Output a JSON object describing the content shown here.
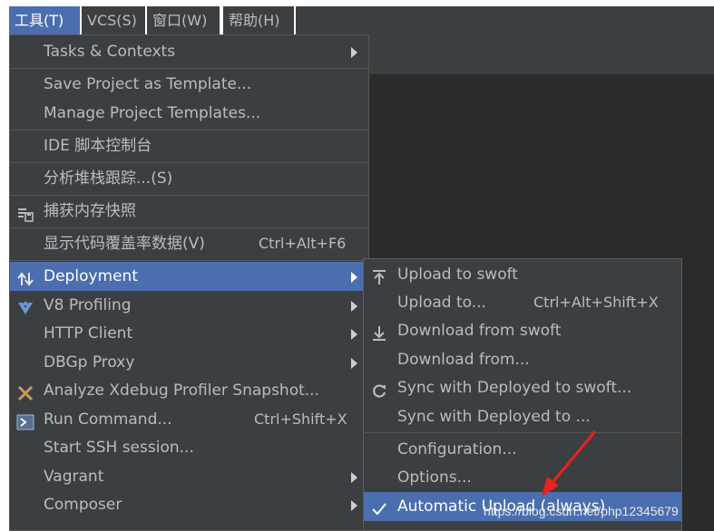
{
  "menubar": {
    "items": [
      {
        "label": "工具(T)"
      },
      {
        "label": "VCS(S)"
      },
      {
        "label": "窗口(W)"
      },
      {
        "label": "帮助(H)"
      }
    ]
  },
  "main_menu": {
    "items": [
      {
        "label": "Tasks & Contexts"
      },
      {
        "label": "Save Project as Template..."
      },
      {
        "label": "Manage Project Templates..."
      },
      {
        "label": "IDE 脚本控制台"
      },
      {
        "label": "分析堆栈跟踪...(S)"
      },
      {
        "label": "捕获内存快照",
        "icon": "memory-snapshot-icon"
      },
      {
        "label": "显示代码覆盖率数据(V)",
        "shortcut": "Ctrl+Alt+F6"
      },
      {
        "label": "Deployment",
        "icon": "deployment-icon",
        "selected": true
      },
      {
        "label": "V8 Profiling",
        "icon": "v8-icon"
      },
      {
        "label": "HTTP Client"
      },
      {
        "label": "DBGp Proxy"
      },
      {
        "label": "Analyze Xdebug Profiler Snapshot...",
        "icon": "xdebug-icon"
      },
      {
        "label": "Run Command...",
        "icon": "terminal-icon",
        "shortcut": "Ctrl+Shift+X"
      },
      {
        "label": "Start SSH session..."
      },
      {
        "label": "Vagrant"
      },
      {
        "label": "Composer"
      }
    ]
  },
  "sub_menu": {
    "items": [
      {
        "label": "Upload to swoft",
        "icon": "upload-icon"
      },
      {
        "label": "Upload to...",
        "shortcut": "Ctrl+Alt+Shift+X"
      },
      {
        "label": "Download from swoft",
        "icon": "download-icon"
      },
      {
        "label": "Download from..."
      },
      {
        "label": "Sync with Deployed to swoft...",
        "icon": "sync-icon"
      },
      {
        "label": "Sync with Deployed to ..."
      },
      {
        "label": "Configuration..."
      },
      {
        "label": "Options..."
      },
      {
        "label": "Automatic Upload (always)",
        "icon": "check-icon",
        "selected": true
      }
    ]
  },
  "watermark": "https://blog.csdn.net/php12345679",
  "colors": {
    "menu_bg": "#3c3f41",
    "selection": "#4b6eaf",
    "text": "#bbbbbb",
    "annotation_arrow": "#e8221f"
  }
}
